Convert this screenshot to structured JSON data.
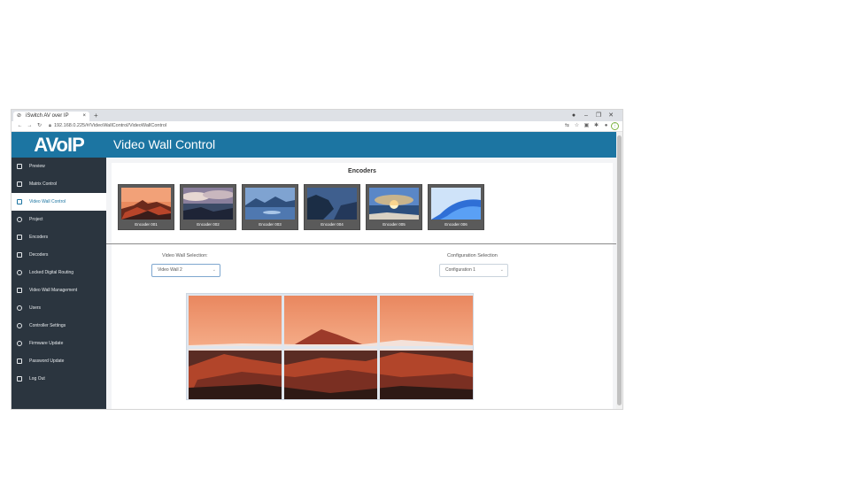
{
  "browser": {
    "tab_title": "iSwitch AV over IP",
    "tab_close": "×",
    "new_tab": "+",
    "url": "192.168.0.225/#/VideoWallControl/VideoWallControl",
    "window_controls": [
      "●",
      "–",
      "❐",
      "✕"
    ]
  },
  "sidebar": {
    "logo": "AVoIP",
    "items": [
      {
        "label": "Preview",
        "icon": "preview-icon",
        "active": false
      },
      {
        "label": "Matrix Control",
        "icon": "matrix-icon",
        "active": false
      },
      {
        "label": "Video Wall Control",
        "icon": "video-wall-icon",
        "active": true
      },
      {
        "label": "Project",
        "icon": "project-icon",
        "active": false
      },
      {
        "label": "Encoders",
        "icon": "encoder-icon",
        "active": false
      },
      {
        "label": "Decoders",
        "icon": "decoder-icon",
        "active": false
      },
      {
        "label": "Locked Digital Routing",
        "icon": "lock-routing-icon",
        "active": false
      },
      {
        "label": "Video Wall Management",
        "icon": "wall-management-icon",
        "active": false
      },
      {
        "label": "Users",
        "icon": "users-icon",
        "active": false
      },
      {
        "label": "Controller Settings",
        "icon": "settings-icon",
        "active": false
      },
      {
        "label": "Firmware Update",
        "icon": "firmware-icon",
        "active": false
      },
      {
        "label": "Password Update",
        "icon": "key-icon",
        "active": false
      },
      {
        "label": "Log Out",
        "icon": "logout-icon",
        "active": false
      }
    ]
  },
  "header": {
    "title": "Video Wall Control"
  },
  "encoders": {
    "title": "Encoders",
    "items": [
      {
        "label": "Encoder 001",
        "scene": "volcano-sunset"
      },
      {
        "label": "Encoder 002",
        "scene": "coast-clouds"
      },
      {
        "label": "Encoder 003",
        "scene": "lake-mountains"
      },
      {
        "label": "Encoder 004",
        "scene": "sea-cliffs"
      },
      {
        "label": "Encoder 005",
        "scene": "sunburst-beach"
      },
      {
        "label": "Encoder 006",
        "scene": "windows-bloom"
      }
    ]
  },
  "selection": {
    "video_wall_label": "Video Wall Selection:",
    "video_wall_value": "Video Wall 2",
    "config_label": "Configuration Selection",
    "config_value": "Configuration 1"
  },
  "wall": {
    "rows": 2,
    "cols": 3,
    "scene": "volcano-sunset"
  },
  "colors": {
    "accent": "#1c75a2",
    "sidebar": "#2b353f"
  }
}
